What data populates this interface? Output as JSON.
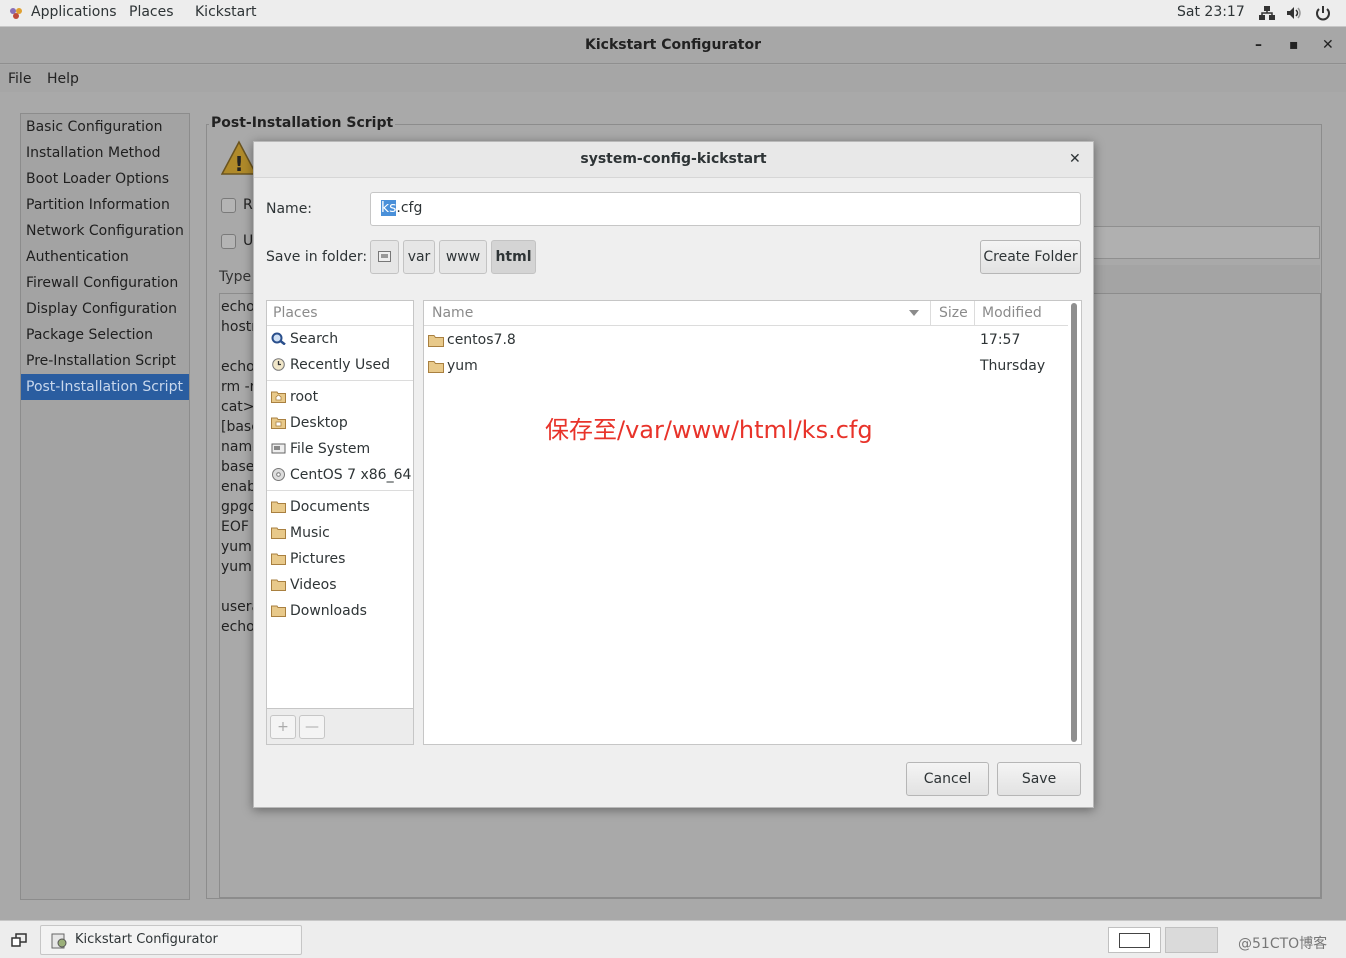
{
  "top_panel": {
    "applications": "Applications",
    "places": "Places",
    "kickstart": "Kickstart",
    "clock": "Sat 23:17",
    "icons": [
      "network-icon",
      "volume-icon",
      "power-icon"
    ]
  },
  "window": {
    "title": "Kickstart Configurator",
    "controls": {
      "minimize": "–",
      "maximize": "▪",
      "close": "✕"
    },
    "menu": {
      "file": "File",
      "help": "Help"
    }
  },
  "sidebar": {
    "items": [
      {
        "label": "Basic Configuration"
      },
      {
        "label": "Installation Method"
      },
      {
        "label": "Boot Loader Options"
      },
      {
        "label": "Partition Information"
      },
      {
        "label": "Network Configuration"
      },
      {
        "label": "Authentication"
      },
      {
        "label": "Firewall Configuration"
      },
      {
        "label": "Display Configuration"
      },
      {
        "label": "Package Selection"
      },
      {
        "label": "Pre-Installation Script"
      },
      {
        "label": "Post-Installation Script"
      }
    ],
    "selected": "Post-Installation Script"
  },
  "post_script": {
    "frame_label": "Post-Installation Script",
    "check1_label": "R",
    "check2_label": "U",
    "type_label": "Type",
    "lines": [
      "echo",
      "hostr",
      "",
      "echo",
      "rm -r",
      "cat>/",
      "[base",
      "name",
      "basel",
      "enabl",
      "gpgcl",
      "EOF",
      "yum (",
      "yum i",
      "",
      "usera",
      "echo"
    ]
  },
  "dialog": {
    "title": "system-config-kickstart",
    "close": "✕",
    "name_label": "Name:",
    "name_value_selected": "ks",
    "name_value_rest": ".cfg",
    "folder_label": "Save in folder:",
    "breadcrumbs": [
      "var",
      "www",
      "html"
    ],
    "create_folder": "Create Folder",
    "places_header": "Places",
    "places": [
      {
        "label": "Search",
        "icon": "search-icon"
      },
      {
        "label": "Recently Used",
        "icon": "recent-icon"
      },
      {
        "label": "root",
        "icon": "home-folder-icon"
      },
      {
        "label": "Desktop",
        "icon": "desktop-folder-icon"
      },
      {
        "label": "File System",
        "icon": "filesystem-icon"
      },
      {
        "label": "CentOS 7 x86_64",
        "icon": "disc-icon"
      },
      {
        "label": "Documents",
        "icon": "folder-icon"
      },
      {
        "label": "Music",
        "icon": "folder-icon"
      },
      {
        "label": "Pictures",
        "icon": "folder-icon"
      },
      {
        "label": "Videos",
        "icon": "folder-icon"
      },
      {
        "label": "Downloads",
        "icon": "folder-icon"
      }
    ],
    "add_btn": "+",
    "remove_btn": "—",
    "columns": {
      "name": "Name",
      "size": "Size",
      "modified": "Modified"
    },
    "files": [
      {
        "name": "centos7.8",
        "size": "",
        "modified": "17:57"
      },
      {
        "name": "yum",
        "size": "",
        "modified": "Thursday"
      }
    ],
    "annotation": "保存至/var/www/html/ks.cfg",
    "cancel": "Cancel",
    "save": "Save"
  },
  "taskbar": {
    "task_label": "Kickstart Configurator",
    "watermark": "@51CTO博客"
  },
  "colors": {
    "selection": "#2a5da0",
    "highlight": "#4a90d9",
    "annotation": "#e8332a"
  }
}
